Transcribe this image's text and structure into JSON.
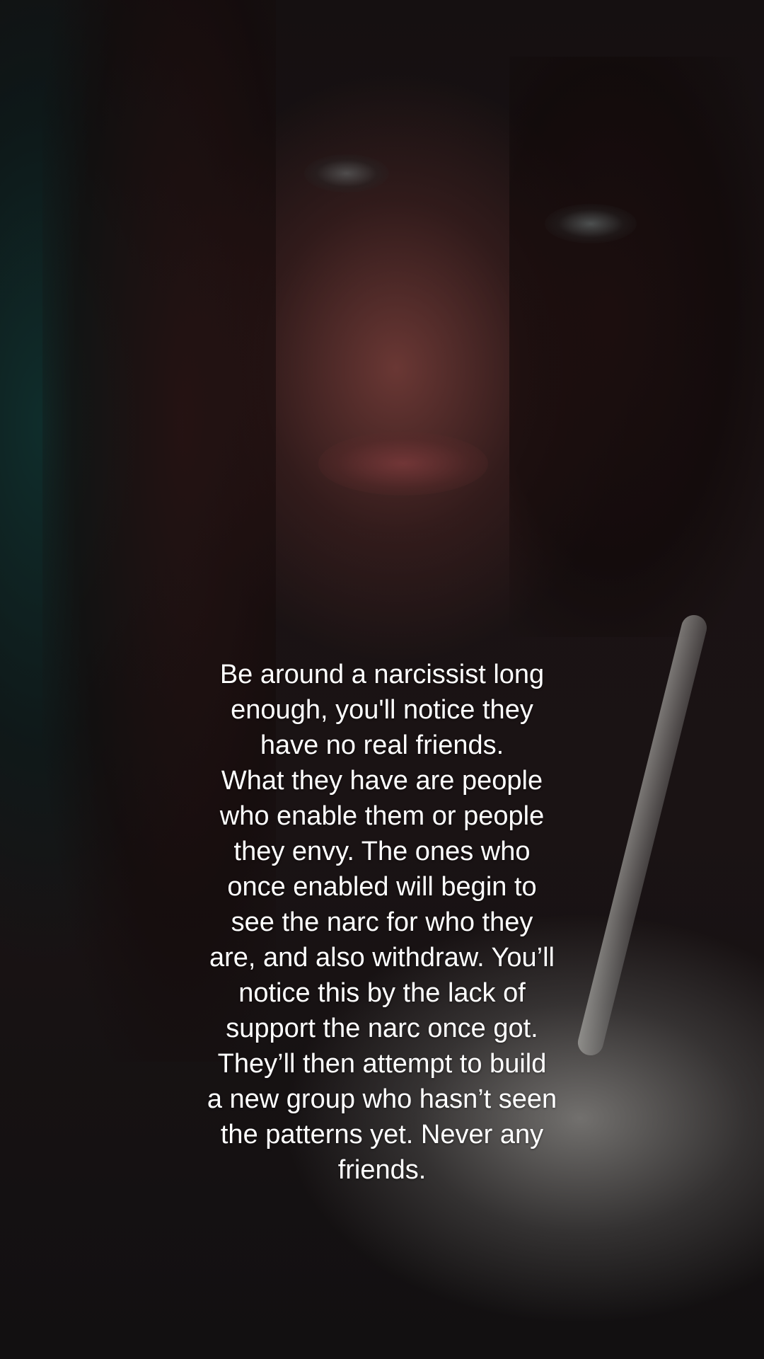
{
  "caption": {
    "text": "Be around a narcissist long\nenough, you'll notice they\nhave no real friends.\nWhat they have are people\nwho enable them or people\nthey envy. The ones who\nonce enabled will begin to\nsee the narc for who they\nare, and also withdraw. You’ll\nnotice this by the lack of\nsupport the narc once got.\nThey’ll then attempt to build\na new group who hasn’t seen\nthe patterns yet. Never any\nfriends.",
    "color": "#ffffff"
  }
}
